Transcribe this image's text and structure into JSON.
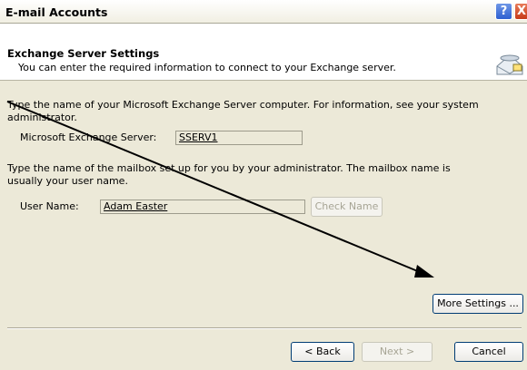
{
  "window": {
    "title": "E-mail Accounts",
    "help_glyph": "?",
    "close_glyph": "X"
  },
  "header": {
    "title": "Exchange Server Settings",
    "subtitle": "You can enter the required information to connect to your Exchange server.",
    "icon": "server-mail-icon"
  },
  "server_section": {
    "instruction": "Type the name of your Microsoft Exchange Server computer. For information, see your system administrator.",
    "label": "Microsoft Exchange Server:",
    "value": "SSERV1"
  },
  "mailbox_section": {
    "instruction": "Type the name of the mailbox set up for you by your administrator. The mailbox name is usually your user name.",
    "label": "User Name:",
    "value": "Adam Easter",
    "check_name_label": "Check Name"
  },
  "buttons": {
    "more_settings": "More Settings ...",
    "back": "< Back",
    "next": "Next >",
    "cancel": "Cancel"
  },
  "colors": {
    "dialog_bg": "#ECE9D8",
    "annotation_arrow": "#000000"
  }
}
